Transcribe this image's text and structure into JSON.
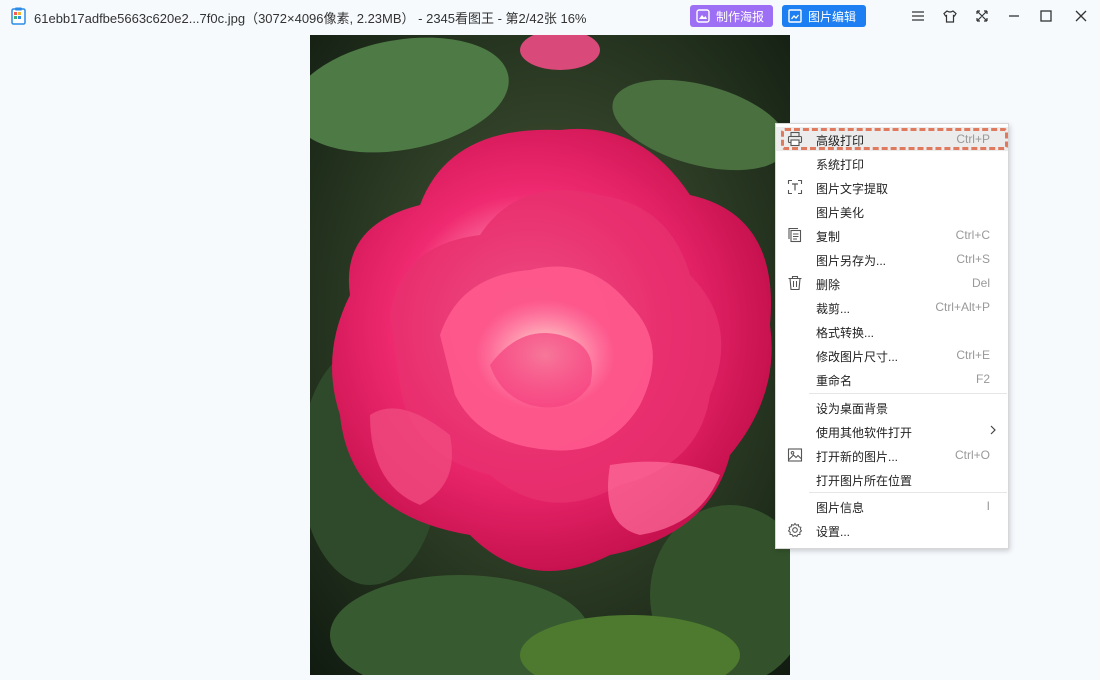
{
  "titlebar": {
    "title": "61ebb17adfbe5663c620e2...7f0c.jpg（3072×4096像素, 2.23MB） - 2345看图王 - 第2/42张 16%",
    "poster_button": "制作海报",
    "edit_button": "图片编辑",
    "controls": [
      "menu-icon",
      "skin-icon",
      "fullscreen-icon",
      "minimize-icon",
      "maximize-icon",
      "close-icon"
    ]
  },
  "colors": {
    "poster_button_bg": "#9c6ff5",
    "edit_button_bg": "#1e7ff2",
    "highlight_border": "#e07a5f"
  },
  "context_menu": {
    "items": [
      {
        "label": "高级打印",
        "shortcut": "Ctrl+P",
        "icon": "printer-icon"
      },
      {
        "label": "系统打印",
        "shortcut": "",
        "icon": ""
      },
      {
        "label": "图片文字提取",
        "shortcut": "",
        "icon": "text-scan-icon"
      },
      {
        "label": "图片美化",
        "shortcut": "",
        "icon": ""
      },
      {
        "label": "复制",
        "shortcut": "Ctrl+C",
        "icon": "copy-icon"
      },
      {
        "label": "图片另存为...",
        "shortcut": "Ctrl+S",
        "icon": ""
      },
      {
        "label": "删除",
        "shortcut": "Del",
        "icon": "trash-icon"
      },
      {
        "label": "裁剪...",
        "shortcut": "Ctrl+Alt+P",
        "icon": ""
      },
      {
        "label": "格式转换...",
        "shortcut": "",
        "icon": ""
      },
      {
        "label": "修改图片尺寸...",
        "shortcut": "Ctrl+E",
        "icon": ""
      },
      {
        "label": "重命名",
        "shortcut": "F2",
        "icon": ""
      },
      {
        "label": "设为桌面背景",
        "shortcut": "",
        "icon": ""
      },
      {
        "label": "使用其他软件打开",
        "shortcut": "",
        "icon": "chevron-right-icon"
      },
      {
        "label": "打开新的图片...",
        "shortcut": "Ctrl+O",
        "icon": "image-icon"
      },
      {
        "label": "打开图片所在位置",
        "shortcut": "",
        "icon": ""
      },
      {
        "label": "图片信息",
        "shortcut": "I",
        "icon": ""
      },
      {
        "label": "设置...",
        "shortcut": "",
        "icon": "gear-icon"
      }
    ]
  }
}
